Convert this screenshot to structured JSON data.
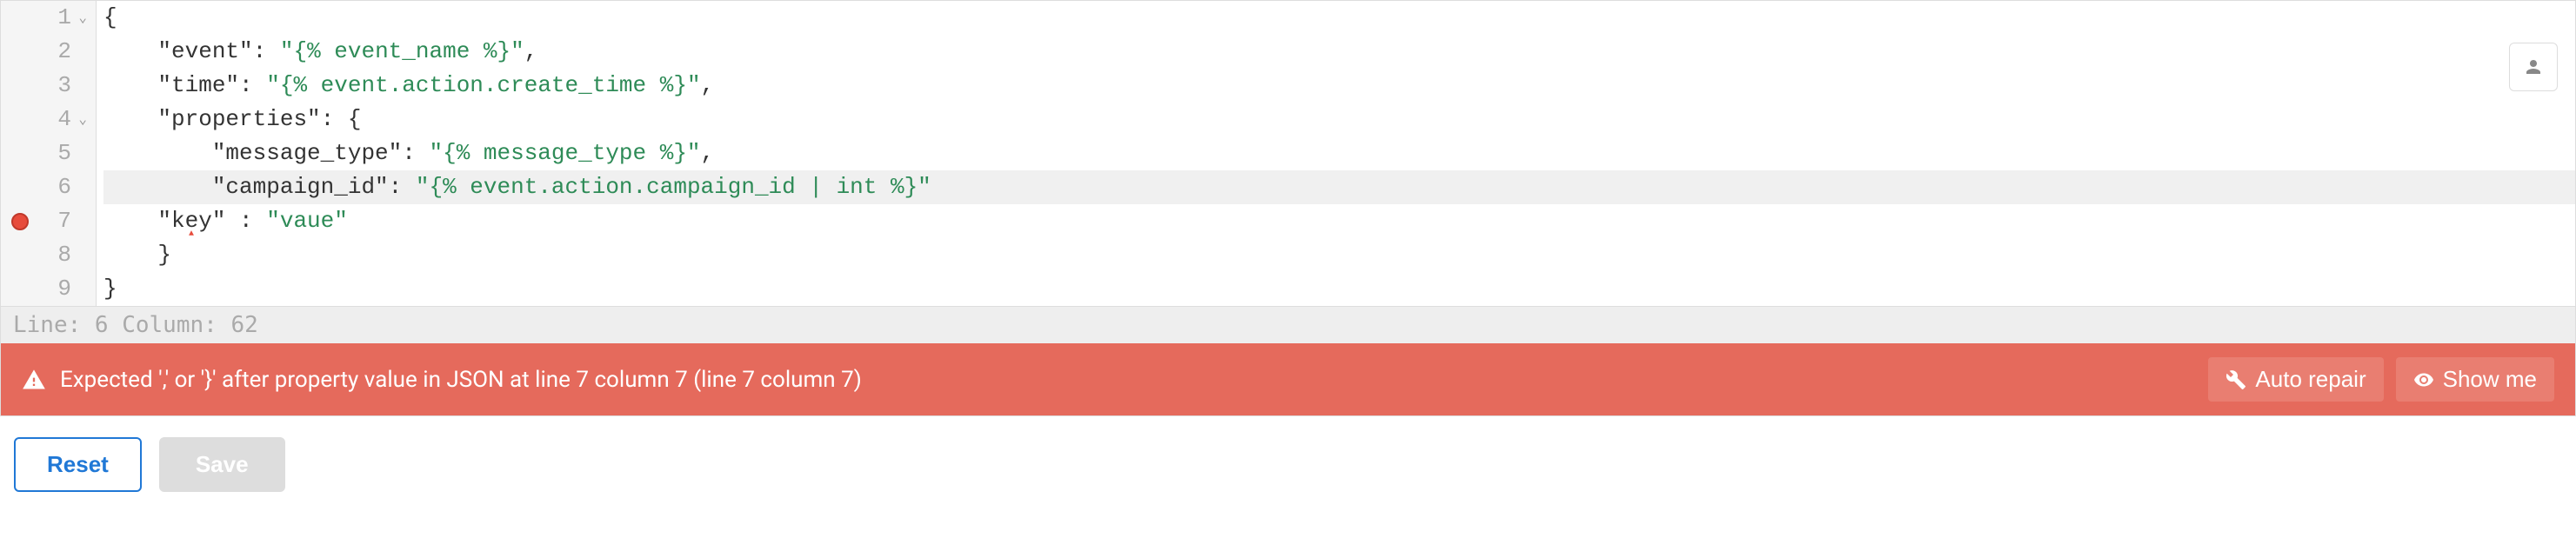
{
  "editor": {
    "lines": [
      {
        "num": 1,
        "fold": true,
        "error": false,
        "highlighted": false,
        "indent": 0,
        "tokens": [
          {
            "t": "punct",
            "v": "{"
          }
        ]
      },
      {
        "num": 2,
        "fold": false,
        "error": false,
        "highlighted": false,
        "indent": 1,
        "tokens": [
          {
            "t": "prop",
            "v": "\"event\""
          },
          {
            "t": "punct",
            "v": ": "
          },
          {
            "t": "str",
            "v": "\"{% event_name %}\""
          },
          {
            "t": "punct",
            "v": ","
          }
        ]
      },
      {
        "num": 3,
        "fold": false,
        "error": false,
        "highlighted": false,
        "indent": 1,
        "tokens": [
          {
            "t": "prop",
            "v": "\"time\""
          },
          {
            "t": "punct",
            "v": ": "
          },
          {
            "t": "str",
            "v": "\"{% event.action.create_time %}\""
          },
          {
            "t": "punct",
            "v": ","
          }
        ]
      },
      {
        "num": 4,
        "fold": true,
        "error": false,
        "highlighted": false,
        "indent": 1,
        "tokens": [
          {
            "t": "prop",
            "v": "\"properties\""
          },
          {
            "t": "punct",
            "v": ": {"
          }
        ]
      },
      {
        "num": 5,
        "fold": false,
        "error": false,
        "highlighted": false,
        "indent": 2,
        "tokens": [
          {
            "t": "prop",
            "v": "\"message_type\""
          },
          {
            "t": "punct",
            "v": ": "
          },
          {
            "t": "str",
            "v": "\"{% message_type %}\""
          },
          {
            "t": "punct",
            "v": ","
          }
        ]
      },
      {
        "num": 6,
        "fold": false,
        "error": false,
        "highlighted": true,
        "indent": 2,
        "tokens": [
          {
            "t": "prop",
            "v": "\"campaign_id\""
          },
          {
            "t": "punct",
            "v": ": "
          },
          {
            "t": "str",
            "v": "\"{% event.action.campaign_id | int %}\""
          }
        ]
      },
      {
        "num": 7,
        "fold": false,
        "error": true,
        "highlighted": false,
        "indent": 1,
        "tokens": [
          {
            "t": "prop",
            "v": "\"key\""
          },
          {
            "t": "punct",
            "v": " : "
          },
          {
            "t": "str",
            "v": "\"vaue\""
          }
        ]
      },
      {
        "num": 8,
        "fold": false,
        "error": false,
        "highlighted": false,
        "indent": 1,
        "tokens": [
          {
            "t": "punct",
            "v": "}"
          }
        ]
      },
      {
        "num": 9,
        "fold": false,
        "error": false,
        "highlighted": false,
        "indent": 0,
        "tokens": [
          {
            "t": "punct",
            "v": "}"
          }
        ]
      }
    ]
  },
  "status": {
    "text": "Line: 6  Column: 62"
  },
  "error": {
    "message": "Expected ',' or '}' after property value in JSON at line 7 column 7 (line 7 column 7)",
    "auto_repair_label": "Auto repair",
    "show_me_label": "Show me"
  },
  "buttons": {
    "reset": "Reset",
    "save": "Save"
  }
}
